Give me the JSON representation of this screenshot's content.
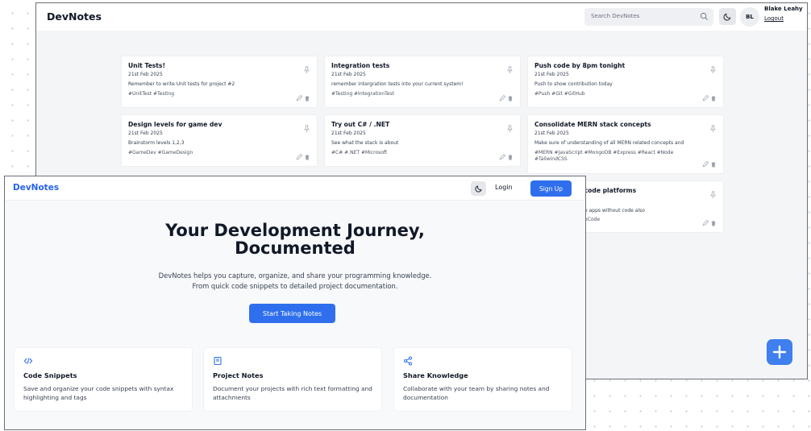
{
  "dashboard": {
    "brand": "DevNotes",
    "search_placeholder": "Search DevNotes",
    "user": {
      "initials": "BL",
      "name": "Blake Leahy",
      "logout": "Logout"
    },
    "notes": [
      {
        "title": "Unit Tests!",
        "date": "21st Feb 2025",
        "body": "Remember to write Unit tests for project #2",
        "tags": "#UnitTest #Testing"
      },
      {
        "title": "Integration tests",
        "date": "21st Feb 2025",
        "body": "remember intergration tests into your current system!",
        "tags": "#Testing #IntegrationTest"
      },
      {
        "title": "Push code by 8pm tonight",
        "date": "21st Feb 2025",
        "body": "Push to show contribution today",
        "tags": "#Push #Git #GitHub"
      },
      {
        "title": "Design levels for game dev",
        "date": "21st Feb 2025",
        "body": "Brainstorm levels 1,2,3",
        "tags": "#GameDev #GameDesign"
      },
      {
        "title": "Try out C# / .NET",
        "date": "21st Feb 2025",
        "body": "See what the stack is about",
        "tags": "#C# #.NET #Microsoft"
      },
      {
        "title": "Consolidate MERN stack concepts",
        "date": "21st Feb 2025",
        "body": "Make sure of understanding of all MERN related concepts and",
        "tags": "#MERN #JavaScript #MongoDB #Express #React #Node #TailwindCSS"
      },
      {
        "title": "w code platforms",
        "date": "",
        "body": "o apps without code also",
        "tags": "eCode"
      }
    ]
  },
  "landing": {
    "brand": "DevNotes",
    "login": "Login",
    "signup": "Sign Up",
    "hero_line1": "Your Development Journey,",
    "hero_line2": "Documented",
    "sub_line1": "DevNotes helps you capture, organize, and share your programming knowledge.",
    "sub_line2": "From quick code snippets to detailed project documentation.",
    "cta": "Start Taking Notes",
    "features": [
      {
        "icon": "code-icon",
        "title": "Code Snippets",
        "desc": "Save and organize your code snippets with syntax highlighting and tags"
      },
      {
        "icon": "notebook-icon",
        "title": "Project Notes",
        "desc": "Document your projects with rich text formatting and attachments"
      },
      {
        "icon": "share-icon",
        "title": "Share Knowledge",
        "desc": "Collaborate with your team by sharing notes and documentation"
      }
    ]
  },
  "colors": {
    "accent": "#2f6fed",
    "brand_text": "#2563eb",
    "fab": "#3f7fee"
  }
}
